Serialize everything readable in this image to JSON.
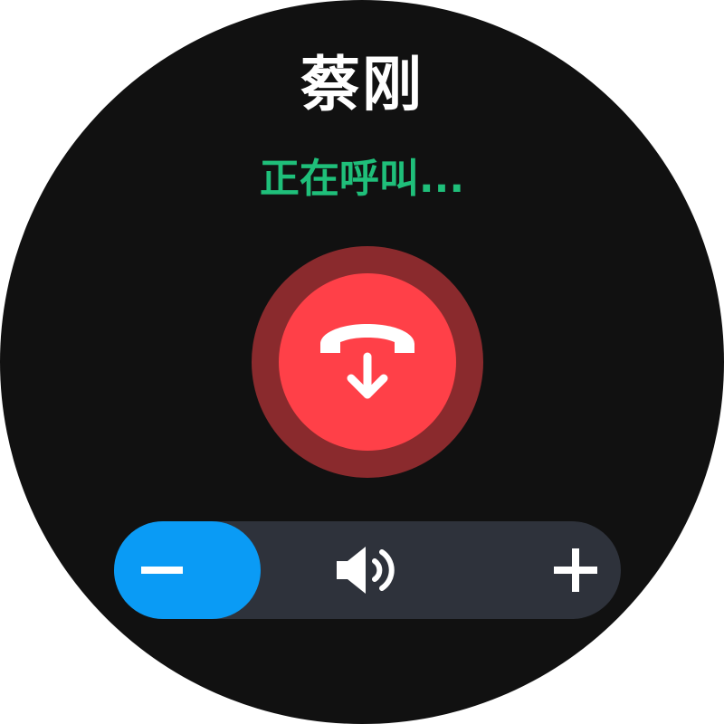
{
  "call": {
    "contact_name": "蔡刚",
    "status": "正在呼叫..."
  },
  "controls": {
    "hangup_icon": "hangup-phone-icon",
    "volume_down_icon": "minus-icon",
    "volume_icon": "speaker-icon",
    "volume_up_icon": "plus-icon"
  },
  "colors": {
    "background": "#111111",
    "status": "#1fbf7a",
    "hangup": "#ff4048",
    "hangup_halo": "#8a2a2d",
    "volume_bar": "#2e323b",
    "volume_accent": "#0a9bf5"
  }
}
